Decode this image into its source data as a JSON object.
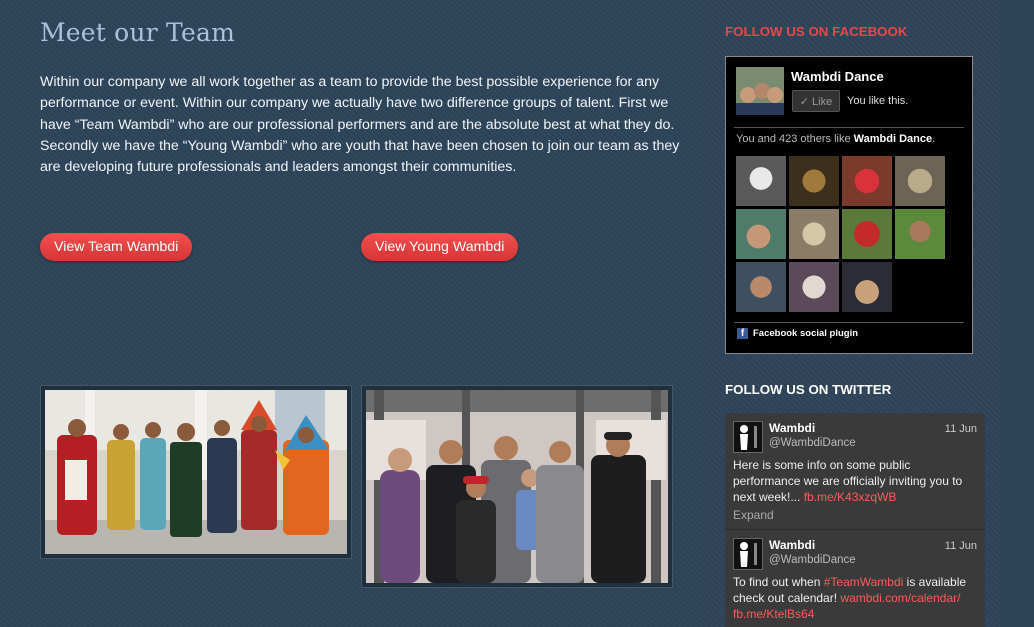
{
  "main": {
    "title": "Meet our Team",
    "intro": "Within our company we all work together as a team to provide the best possible experience for any performance or event. Within our company we actually have two difference groups of talent. First we have “Team Wambdi” who are our professional performers and are the absolute best at what they do. Secondly we have the “Young Wambdi” who are youth that have been chosen to join our team as they are developing future professionals and leaders amongst their communities.",
    "buttons": {
      "team": "View Team Wambdi",
      "young": "View Young Wambdi"
    }
  },
  "sidebar": {
    "facebook": {
      "heading": "FOLLOW US ON FACEBOOK",
      "page_name": "Wambdi Dance",
      "like_button": "✓ Like",
      "you_like": "You like this.",
      "count_prefix": "You and 423 others like ",
      "count_page": "Wambdi Dance",
      "count_suffix": ".",
      "plugin_label": "Facebook social plugin",
      "icon": "facebook-icon"
    },
    "twitter": {
      "heading": "FOLLOW US ON TWITTER",
      "tweets": [
        {
          "name": "Wambdi",
          "handle": "@WambdiDance",
          "date": "11 Jun",
          "text": "Here is some info on some public performance we are officially inviting you to next week!... ",
          "link": "fb.me/K43xzqWB",
          "expand": "Expand"
        },
        {
          "name": "Wambdi",
          "handle": "@WambdiDance",
          "date": "11 Jun",
          "text_before": "To find out when ",
          "hashtag": "#TeamWambdi",
          "text_after": " is available check out calendar! ",
          "link1": "wambdi.com/calendar/",
          "link2": "fb.me/KtelBs64"
        }
      ]
    }
  },
  "colors": {
    "background": "#2d4459",
    "accent": "#e8403f",
    "title": "#a8c3d9",
    "link": "#ff5a5a"
  }
}
